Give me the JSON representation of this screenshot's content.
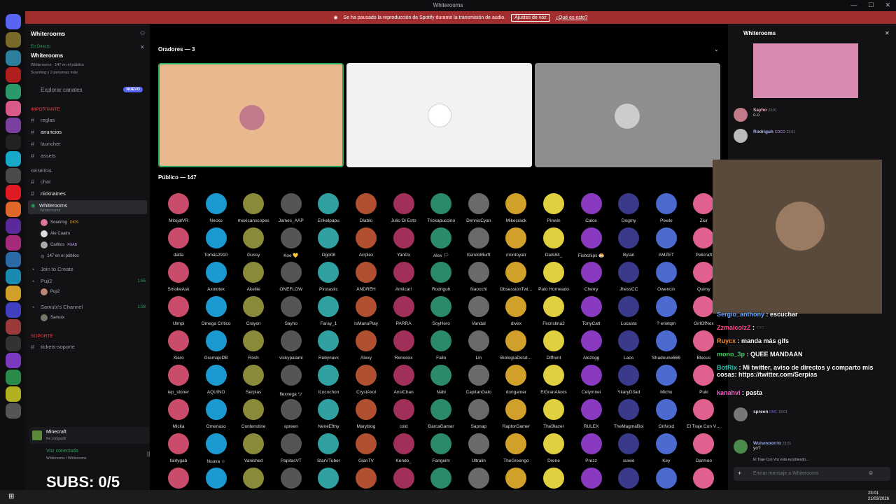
{
  "window": {
    "title": "Whiterooms"
  },
  "banner": {
    "text": "Se ha pausado la reproducción de Spotify durante la transmisión de audio.",
    "button": "Ajustes de voz",
    "link": "¿Qué es esto?"
  },
  "sidebar": {
    "server_name": "Whiterooms",
    "live": {
      "badge": "En Directo",
      "title": "Whiterooms",
      "sub": "Whiterooms · 147 en el público",
      "sub2": "Soarinng y 2 personas más"
    },
    "explore": {
      "label": "Explorar canales",
      "badge": "NUEVO"
    },
    "cat_importante": "IMPORTANTE",
    "ch_reglas": "reglas",
    "ch_anuncios": "anuncios",
    "ch_launcher": "launcher",
    "ch_assets": "assets",
    "cat_general": "GENERAL",
    "ch_chat": "chat",
    "ch_nicknames": "nicknames",
    "stage": {
      "name": "Whiterooms",
      "sub": "Whiterooms"
    },
    "stage_users": [
      {
        "name": "Soarinng",
        "tag": "DIOS"
      },
      {
        "name": "Ale Cuatro",
        "tag": ""
      },
      {
        "name": "Carlitos",
        "tag": "FGAB"
      }
    ],
    "stage_audience": "147 en el público",
    "join": "Join to Create",
    "puji": {
      "name": "Puji2",
      "time": "1:55",
      "user": "Puji2"
    },
    "samulx": {
      "name": "Samulx's Channel",
      "time": "1:38",
      "user": "Samulx"
    },
    "cat_soporte": "SOPORTE",
    "ch_tickets": "tickets-soporte",
    "activity": {
      "name": "Minecraft",
      "sub": "No compartir"
    },
    "voice": {
      "status": "Voz conectada",
      "sub": "Whiterooms / Whiterooms"
    }
  },
  "stage": {
    "speakers_label": "Oradores — 3",
    "audience_label": "Público — 147",
    "tile_colors": [
      "#e8b98f",
      "#f2f2f2",
      "#8e8e8e"
    ],
    "audience": [
      "MitojalVR",
      "Necko",
      "mexicanscopes",
      "James_AAP",
      "Erikelpapu",
      "Diablo",
      "Julio Di Esto",
      "Trickapuccino",
      "DennisCyan",
      "Mikecrack",
      "Pinwin",
      "Calce",
      "Dogmy",
      "Pixelo",
      "Ziur",
      "datta",
      "Tomás2910",
      "Gussy",
      "Koe 💛",
      "Dgo08",
      "Arrplex",
      "YanDx",
      "Alex 🏳",
      "KendoMurft",
      "montoyatr",
      "Dark84_",
      "Fishchips 🍮",
      "Bylan",
      "AMZET",
      "Pelicraft",
      "SmokeAsk",
      "Axolotex",
      "Akellie",
      "ONEFLOW",
      "Pirutastic",
      "ANDREH",
      "Amilcar!",
      "Rodriguh",
      "Naocchi",
      "ObsessionTwi…",
      "Pato Horneado",
      "Cherry",
      "JhessCC",
      "Owencin",
      "Quimy",
      "Ulmpi",
      "Omega Crítico",
      "Crayon",
      "Sayho",
      "Faray_1",
      "IsManuPlay",
      "PARRA",
      "SoyHero",
      "Vandal",
      "divex",
      "Fkcristina2",
      "TonyCatt",
      "Lucasta",
      "? erietqm",
      "GirlOfNox",
      "Xiaro",
      "GramajoDB",
      "Rosh",
      "vickypalami",
      "Rubynavx",
      "Alexy",
      "Renooxx",
      "Fallo",
      "Lin",
      "BiologíaDesd…",
      "Diffrent",
      "Alezogg",
      "Laos",
      "Shadoune666",
      "Blecus",
      "iep_stoner",
      "AQUINO",
      "Serpias",
      "flexvega ツ",
      "ILocochon",
      "CrystAxol",
      "AnsiChan",
      "Nabi",
      "CapitanGato",
      "dongamer",
      "ElGranAlexis",
      "Celymnei",
      "YkaryD3ad",
      "Michu",
      "Puki",
      "Micka",
      "Omenaso",
      "Contenstine",
      "spreen",
      "NeneEfthy",
      "Maryblog",
      "cold",
      "BarcaGamer",
      "Sapnap",
      "RaptorGamer",
      "TheBlazer",
      "RULEX",
      "TheMagmaBoi",
      "Grifvoid",
      "El Traje Con V…",
      "fairlygab",
      "Nuuva ☆",
      "Vanished",
      "PapitasVT",
      "StarVTuber",
      "GianTV",
      "Kendo_",
      "Fangeim",
      "Ultralin",
      "TheGreengo",
      "Drene",
      "Prezz",
      "suwie",
      "Key",
      "Darmoo",
      "",
      "",
      "",
      "",
      "",
      "",
      "",
      "",
      "",
      "",
      "",
      "",
      "",
      "",
      ""
    ]
  },
  "chat": {
    "title": "Whiterooms",
    "messages": [
      {
        "user": "Sayho",
        "time": "23:01",
        "text": "o.o"
      },
      {
        "user": "Rodriguh",
        "tag": "COCO",
        "time": "23:01",
        "text": ""
      },
      {
        "user": "spreen",
        "tag": "DMC",
        "time": "23:01",
        "text": ""
      },
      {
        "user": "Wuismoorrio",
        "time": "23:01",
        "text": "yo?"
      }
    ],
    "typing": "El Traje Con Voz está escribiendo…",
    "input_placeholder": "Enviar mensaje a Whiterooms"
  },
  "stream_chat": [
    {
      "user": "Sergio_anthony",
      "text": ": escuchar",
      "color": "#6aa7ff"
    },
    {
      "user": "ZzmaicolzZ",
      "text": ": 🕶️",
      "color": "#ff4d8d"
    },
    {
      "user": "Ruycx",
      "text": ": manda más gifs",
      "color": "#ff8a2a"
    },
    {
      "user": "mono_3p",
      "text": ": QUEE MANDAAN",
      "color": "#42d05f"
    },
    {
      "user": "BotRix",
      "text": ": Mi twitter, aviso de directos y comparto mis cosas: https://twitter.com/Serpias",
      "color": "#2ac6b5"
    },
    {
      "user": "kanahvi",
      "text": ": pasta",
      "color": "#ff5cd0"
    }
  ],
  "overlay": {
    "subs": "SUBS: 0/5"
  },
  "taskbar": {
    "time": "23:01",
    "date": "21/03/2026"
  }
}
